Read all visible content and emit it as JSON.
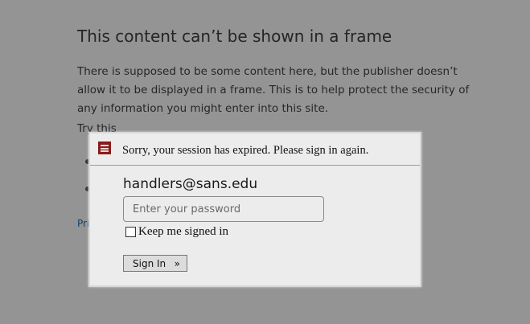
{
  "background_page": {
    "title": "This content can’t be shown in a frame",
    "paragraph": "There is supposed to be some content here, but the publisher doesn’t allow it to be displayed in a frame. This is to help protect the security of any information you might enter into this site.",
    "try_this": "Try this",
    "link_partial": "Pri"
  },
  "dialog": {
    "logo_icon": "sans-logo-icon",
    "message": "Sorry, your session has expired. Please sign in again.",
    "username": "handlers@sans.edu",
    "password": {
      "value": "",
      "placeholder": "Enter your password"
    },
    "keep_signed_in_label": "Keep me signed in",
    "keep_signed_in_checked": false,
    "sign_in_label": "Sign In",
    "sign_in_arrow": "»"
  },
  "colors": {
    "overlay": "#000000",
    "dialog_bg": "#ececec",
    "logo": "#8b1a1a",
    "link": "#2a6ebb"
  }
}
